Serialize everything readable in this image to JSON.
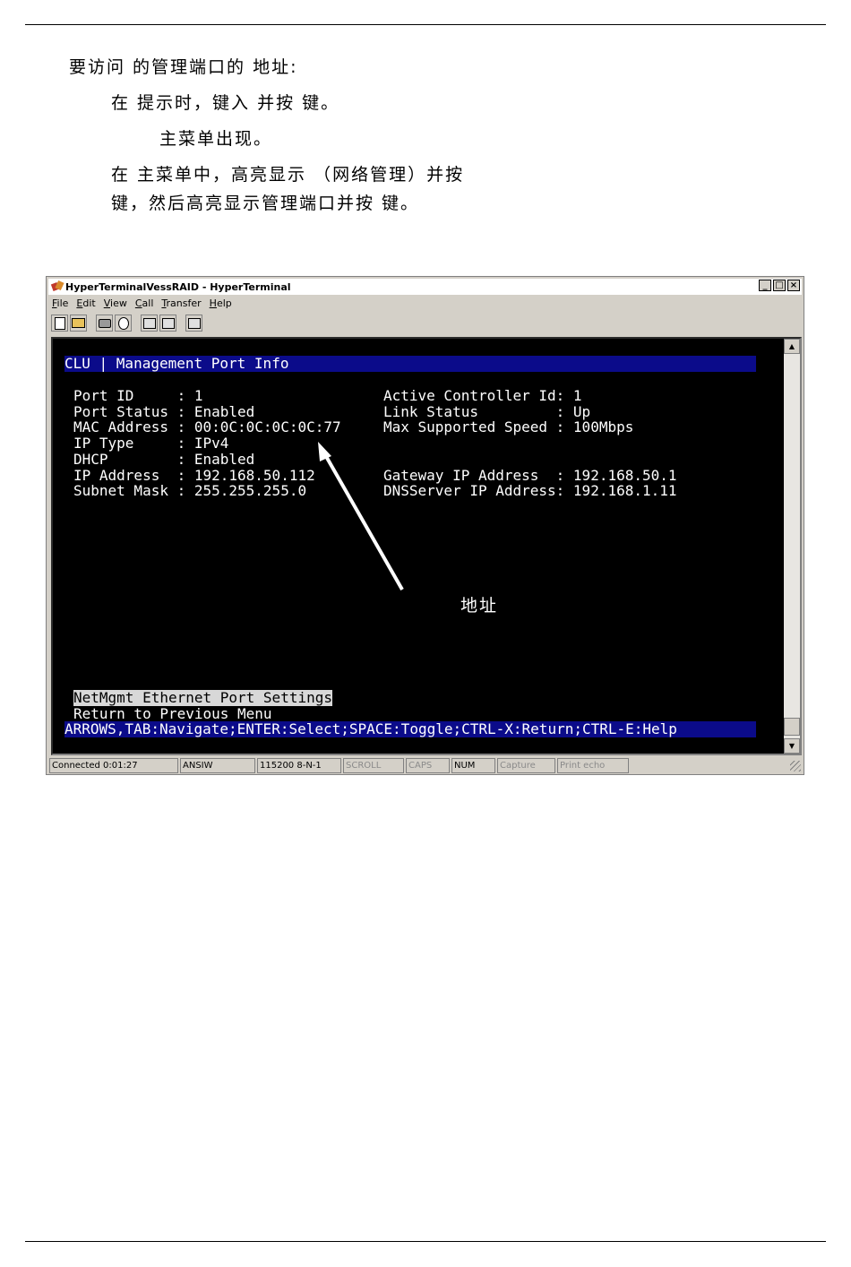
{
  "document": {
    "line1": "要访问                    的管理端口的         地址:",
    "line2": "在                              提示时，键入            并按           键。",
    "line3": "主菜单出现。",
    "line4": "在          主菜单中，高亮显示                                              （网络管理）并按",
    "line5": "键，然后高亮显示管理端口并按             键。"
  },
  "window": {
    "title": "HyperTerminalVessRAID - HyperTerminal",
    "controls": [
      "_",
      "□",
      "×"
    ],
    "menu": [
      {
        "underline": "F",
        "rest": "ile"
      },
      {
        "underline": "E",
        "rest": "dit"
      },
      {
        "underline": "V",
        "rest": "iew"
      },
      {
        "underline": "C",
        "rest": "all"
      },
      {
        "underline": "T",
        "rest": "ransfer"
      },
      {
        "underline": "H",
        "rest": "elp"
      }
    ],
    "toolbar_icons": [
      "new-icon",
      "open-icon",
      "disconnect-icon",
      "dial-icon",
      "send-icon",
      "receive-icon",
      "properties-icon"
    ]
  },
  "terminal": {
    "header": "CLU | Management Port Info",
    "left": [
      "Port ID     : 1",
      "Port Status : Enabled",
      "MAC Address : 00:0C:0C:0C:0C:77",
      "IP Type     : IPv4",
      "DHCP        : Enabled",
      "IP Address  : 192.168.50.112",
      "Subnet Mask : 255.255.255.0"
    ],
    "right": [
      "Active Controller Id: 1",
      "Link Status         : Up",
      "Max Supported Speed : 100Mbps",
      "",
      "",
      "Gateway IP Address  : 192.168.50.1",
      "DNSServer IP Address: 192.168.1.11"
    ],
    "menu_selected": "NetMgmt Ethernet Port Settings",
    "menu_item": "Return to Previous Menu",
    "help_bar": "ARROWS,TAB:Navigate;ENTER:Select;SPACE:Toggle;CTRL-X:Return;CTRL-E:Help",
    "callout": "地址"
  },
  "statusbar": {
    "connected": "Connected 0:01:27",
    "emulation": "ANSIW",
    "port_settings": "115200 8-N-1",
    "scroll": "SCROLL",
    "caps": "CAPS",
    "num": "NUM",
    "capture": "Capture",
    "print_echo": "Print echo"
  }
}
